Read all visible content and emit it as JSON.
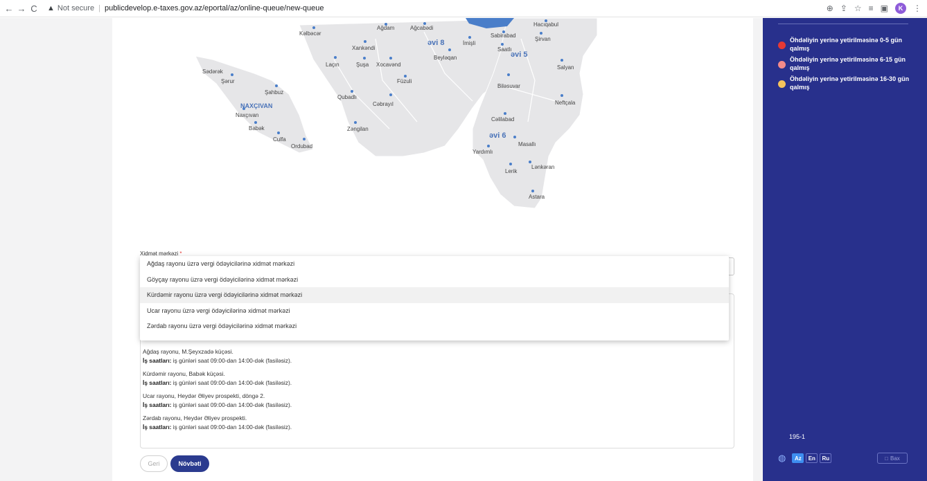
{
  "browser": {
    "nav_back": "←",
    "nav_forward": "→",
    "reload": "C",
    "security": "Not secure",
    "url": "publicdevelop.e-taxes.gov.az/eportal/az/online-queue/new-queue",
    "profile_initial": "K"
  },
  "map": {
    "zones": [
      "əvi 8",
      "əvi 5",
      "əvi 6",
      "NAXÇIVAN"
    ],
    "places": [
      "Kəlbəcər",
      "Ağdam",
      "Ağcabədi",
      "Hacıqabul",
      "Sabirabad",
      "Şirvan",
      "Xankəndi",
      "İmişli",
      "Saatlı",
      "Beyləqan",
      "Salyan",
      "Laçın",
      "Şuşa",
      "Xocavənd",
      "Sədərək",
      "Şərur",
      "Şahbuz",
      "Füzuli",
      "Biləsuvar",
      "Qubadlı",
      "Cəbrayıl",
      "Neftçala",
      "Naxçıvan",
      "Babək",
      "Culfa",
      "Ordubad",
      "Zəngilan",
      "Cəlilabad",
      "Masallı",
      "Yardımlı",
      "Lerik",
      "Lənkəran",
      "Astara"
    ]
  },
  "form": {
    "field_label": "Xidmət mərkəzi",
    "required_mark": "*",
    "options": [
      "Ağdaş rayonu üzrə vergi ödəyicilərinə xidmət mərkəzi",
      "Göyçay rayonu üzrə vergi ödəyicilərinə xidmət mərkəzi",
      "Kürdəmir rayonu üzrə vergi ödəyicilərinə xidmət mərkəzi",
      "Ucar rayonu üzrə vergi ödəyicilərinə xidmət mərkəzi",
      "Zərdab rayonu üzrə vergi ödəyicilərinə xidmət mərkəzi"
    ],
    "highlighted_option": "Kürdəmir rayonu üzrə vergi ödəyicilərinə xidmət mərkəzi",
    "hours_label": "İş saatları:",
    "hours_value": "iş günləri saat 09:00-dan 14:00-dək (fasiləsiz).",
    "addresses": [
      "Ağdaş rayonu, M.Şeyxzadə küçəsi.",
      "Kürdəmir rayonu, Babək küçəsi.",
      "Ucar rayonu, Heydər Əliyev prospekti, döngə 2.",
      "Zərdab rayonu, Heydər Əliyev prospekti."
    ],
    "back_button": "Geri",
    "next_button": "Növbəti"
  },
  "sidebar": {
    "legend": [
      {
        "label": "Öhdəliyin yerinə yetirilməsinə 0-5 gün qalmış",
        "color": "#e53935"
      },
      {
        "label": "Öhdəliyin yerinə yetirilməsinə 6-15 gün qalmış",
        "color": "#f48a8a"
      },
      {
        "label": "Öhdəliyin yerinə yetirilməsinə 16-30 gün qalmış",
        "color": "#f6c35c"
      }
    ],
    "code": "195-1",
    "languages": [
      "Az",
      "En",
      "Ru"
    ],
    "active_language": "Az",
    "bottom_button": "Bax"
  },
  "colors": {
    "sidebar_bg": "#28308c",
    "primary_button": "#2b3b8f",
    "map_land": "#e6e6e8",
    "map_water": "#4a7ec9"
  }
}
